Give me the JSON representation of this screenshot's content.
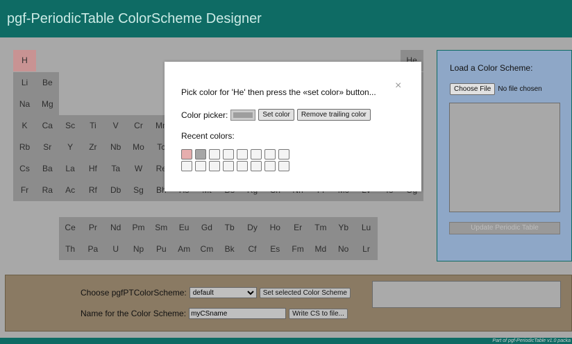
{
  "header": {
    "title": "pgf-PeriodicTable ColorScheme Designer"
  },
  "footer": {
    "text": "Part of pgf-PeriodicTable v1.0 packa"
  },
  "table": {
    "H": "H",
    "He": "He",
    "row2": [
      "Li",
      "Be"
    ],
    "row3": [
      "Na",
      "Mg"
    ],
    "row4": [
      "K",
      "Ca",
      "Sc",
      "Ti",
      "V",
      "Cr",
      "Mn"
    ],
    "row5": [
      "Rb",
      "Sr",
      "Y",
      "Zr",
      "Nb",
      "Mo",
      "Tc"
    ],
    "row6": [
      "Cs",
      "Ba",
      "La",
      "Hf",
      "Ta",
      "W",
      "Re"
    ],
    "row7": [
      "Fr",
      "Ra",
      "Ac",
      "Rf",
      "Db",
      "Sg",
      "Bh",
      "Hs",
      "Mt",
      "Ds",
      "Rg",
      "Cn",
      "Nh",
      "Fl",
      "Mc",
      "Lv",
      "Ts",
      "Og"
    ],
    "lanth": [
      "Ce",
      "Pr",
      "Nd",
      "Pm",
      "Sm",
      "Eu",
      "Gd",
      "Tb",
      "Dy",
      "Ho",
      "Er",
      "Tm",
      "Yb",
      "Lu"
    ],
    "actin": [
      "Th",
      "Pa",
      "U",
      "Np",
      "Pu",
      "Am",
      "Cm",
      "Bk",
      "Cf",
      "Es",
      "Fm",
      "Md",
      "No",
      "Lr"
    ]
  },
  "right_panel": {
    "title": "Load a Color Scheme:",
    "choose_file": "Choose File",
    "no_file": "No file chosen",
    "update_btn": "Update Periodic Table"
  },
  "bottom_panel": {
    "choose_label": "Choose pgfPTColorScheme:",
    "selected": "default",
    "set_btn": "Set selected Color Scheme",
    "name_label": "Name for the Color Scheme:",
    "name_value": "myCSname",
    "write_btn": "Write CS to file..."
  },
  "modal": {
    "prompt": "Pick color for 'He' then press the «set color» button...",
    "close": "×",
    "picker_label": "Color picker:",
    "set_color": "Set color",
    "remove_color": "Remove trailing color",
    "recent_label": "Recent colors:",
    "recent_colors": [
      "#e6aeae",
      "#a6a6a6",
      "#f4f4f4",
      "#f4f4f4",
      "#f4f4f4",
      "#f4f4f4",
      "#f4f4f4",
      "#f4f4f4",
      "#f4f4f4",
      "#f4f4f4",
      "#f4f4f4",
      "#f4f4f4",
      "#f4f4f4",
      "#f4f4f4",
      "#f4f4f4",
      "#f4f4f4"
    ]
  }
}
